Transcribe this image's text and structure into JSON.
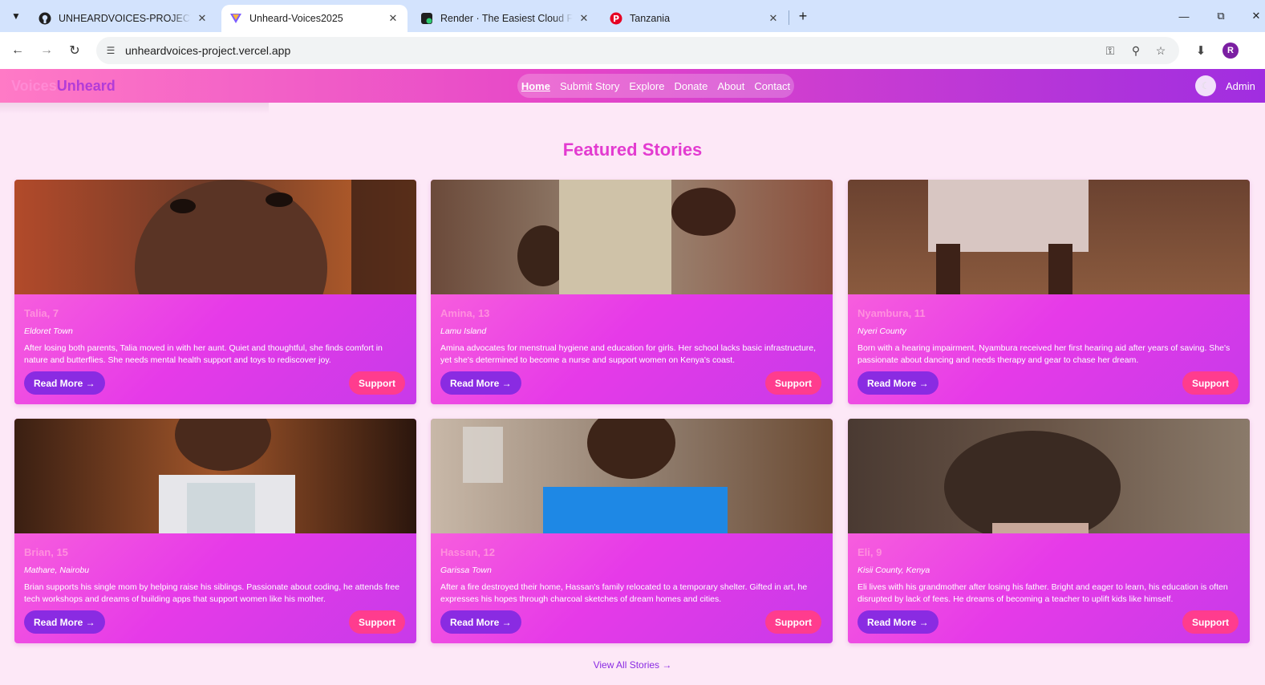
{
  "browser": {
    "tabs": [
      {
        "title": "UNHEARDVOICES-PROJECT/ at",
        "icon": "github-icon",
        "active": false
      },
      {
        "title": "Unheard-Voices2025",
        "icon": "vercel-icon",
        "active": true
      },
      {
        "title": "Render · The Easiest Cloud For A",
        "icon": "render-icon",
        "active": false
      },
      {
        "title": "Tanzania",
        "icon": "pinterest-icon",
        "active": false
      }
    ],
    "url": "unheardvoices-project.vercel.app",
    "profile_initial": "R"
  },
  "site": {
    "logo_part1": "Voices",
    "logo_part2": "Unheard",
    "nav": [
      "Home",
      "Submit Story",
      "Explore",
      "Donate",
      "About",
      "Contact"
    ],
    "active_nav": "Home",
    "admin_label": "Admin",
    "accent": "#e33bd0"
  },
  "featured": {
    "title": "Featured Stories",
    "view_all": "View All Stories →",
    "read_more_label": "Read More →",
    "support_label": "Support",
    "stories": [
      {
        "name": "Talia, 7",
        "location": "Eldoret Town",
        "description": "After losing both parents, Talia moved in with her aunt. Quiet and thoughtful, she finds comfort in nature and butterflies. She needs mental health support and toys to rediscover joy."
      },
      {
        "name": "Amina, 13",
        "location": "Lamu Island",
        "description": "Amina advocates for menstrual hygiene and education for girls. Her school lacks basic infrastructure, yet she's determined to become a nurse and support women on Kenya's coast."
      },
      {
        "name": "Nyambura, 11",
        "location": "Nyeri County",
        "description": "Born with a hearing impairment, Nyambura received her first hearing aid after years of saving. She's passionate about dancing and needs therapy and gear to chase her dream."
      },
      {
        "name": "Brian, 15",
        "location": "Mathare, Nairobu",
        "description": "Brian supports his single mom by helping raise his siblings. Passionate about coding, he attends free tech workshops and dreams of building apps that support women like his mother."
      },
      {
        "name": "Hassan, 12",
        "location": "Garissa Town",
        "description": "After a fire destroyed their home, Hassan's family relocated to a temporary shelter. Gifted in art, he expresses his hopes through charcoal sketches of dream homes and cities."
      },
      {
        "name": "Eli, 9",
        "location": "Kisii County, Kenya",
        "description": "Eli lives with his grandmother after losing his father. Bright and eager to learn, his education is often disrupted by lack of fees. He dreams of becoming a teacher to uplift kids like himself."
      }
    ]
  }
}
